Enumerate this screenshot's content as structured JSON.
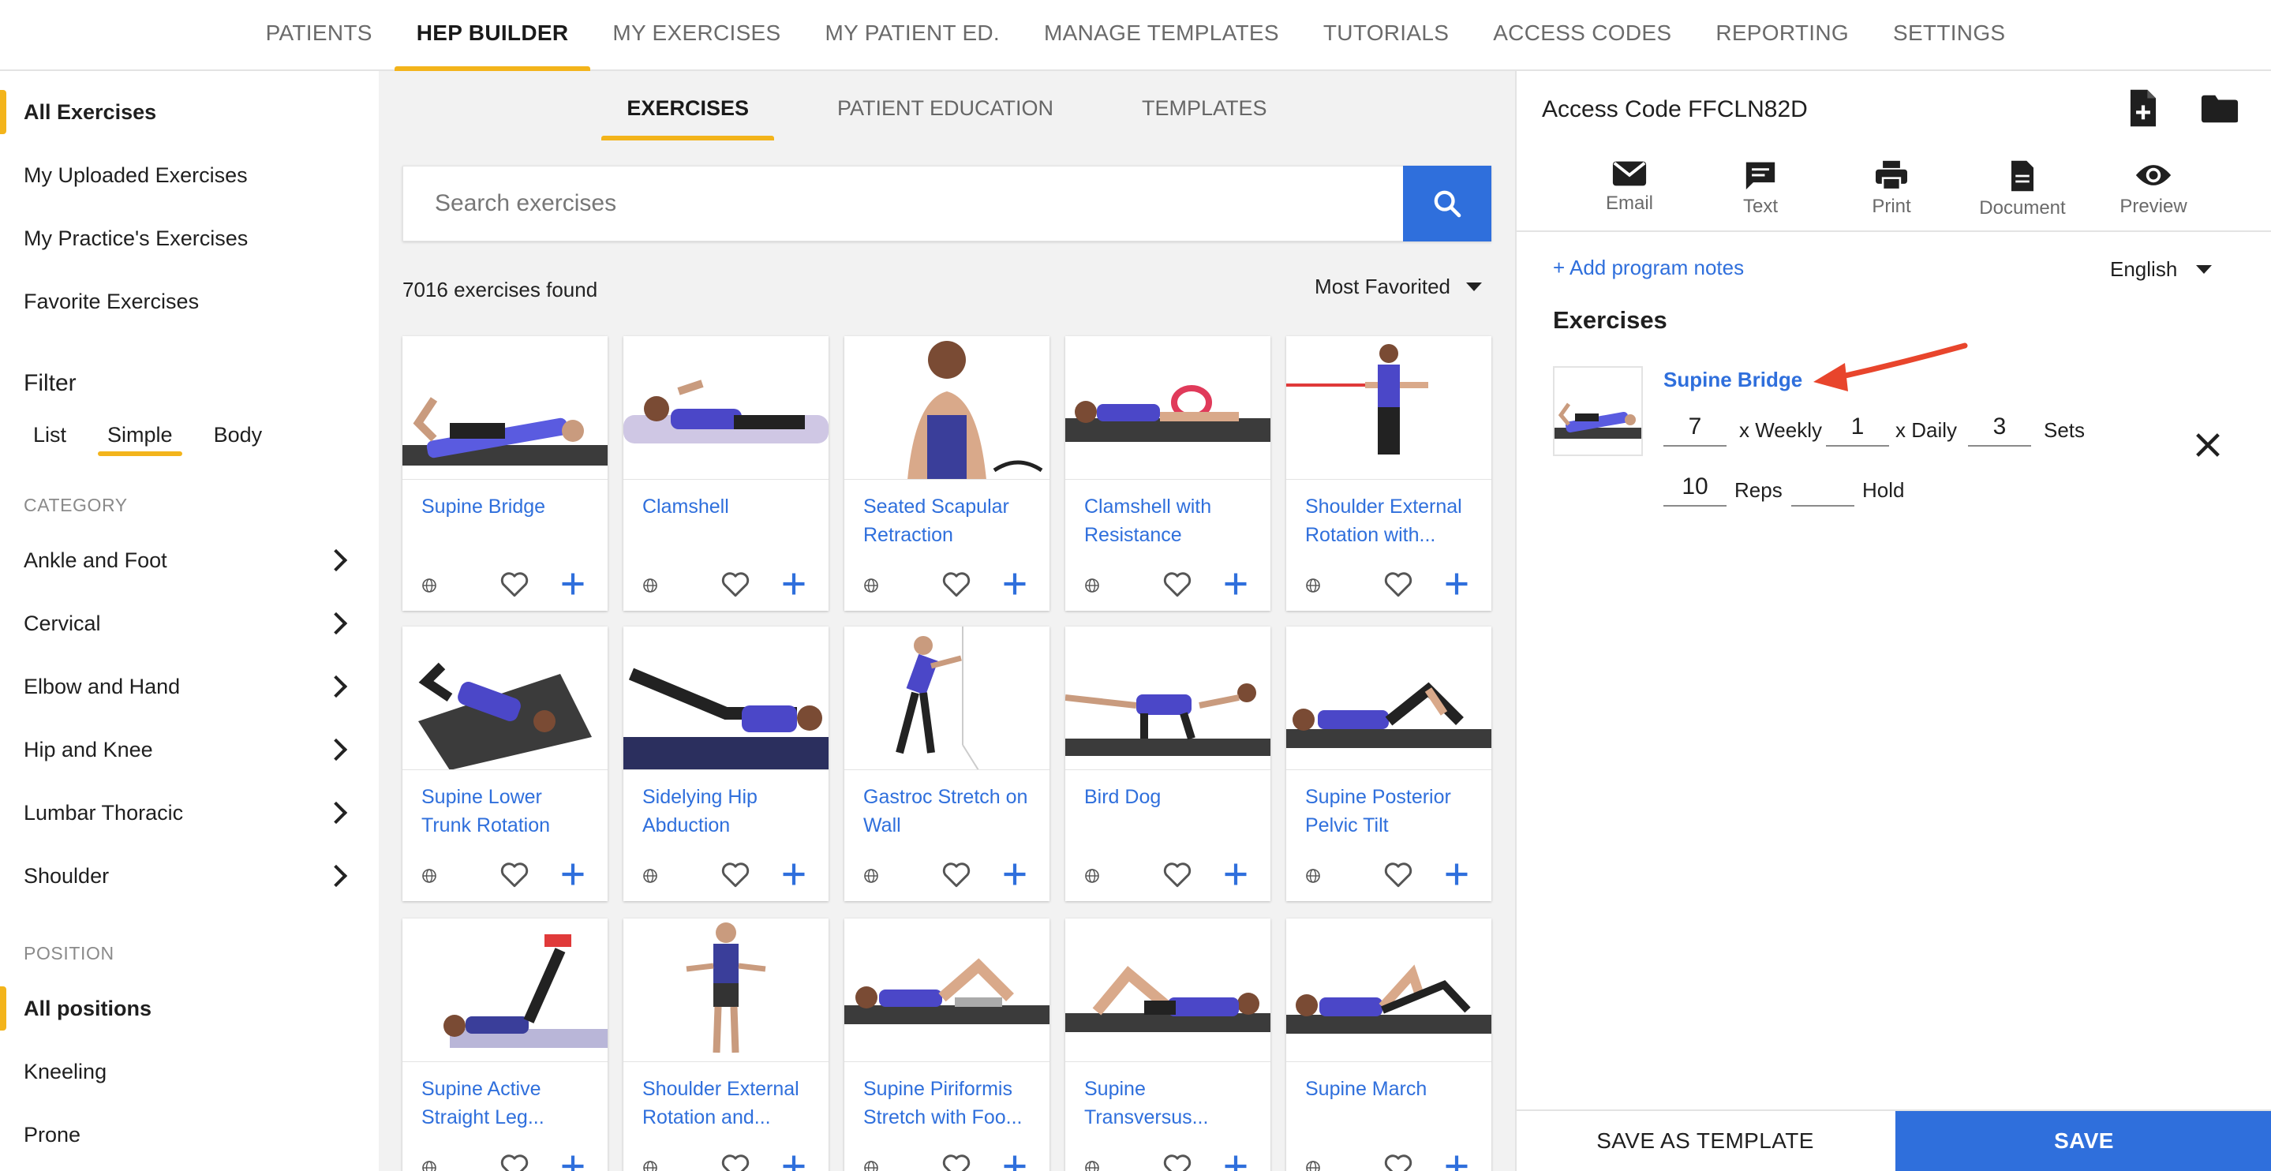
{
  "topnav": {
    "tabs": [
      "PATIENTS",
      "HEP BUILDER",
      "MY EXERCISES",
      "MY PATIENT ED.",
      "MANAGE TEMPLATES",
      "TUTORIALS",
      "ACCESS CODES",
      "REPORTING",
      "SETTINGS"
    ],
    "active": "HEP BUILDER"
  },
  "sidebar": {
    "links": [
      "All Exercises",
      "My Uploaded Exercises",
      "My Practice's Exercises",
      "Favorite Exercises"
    ],
    "filter_title": "Filter",
    "filter_tabs": [
      "List",
      "Simple",
      "Body"
    ],
    "category_label": "CATEGORY",
    "categories": [
      "Ankle and Foot",
      "Cervical",
      "Elbow and Hand",
      "Hip and Knee",
      "Lumbar Thoracic",
      "Shoulder"
    ],
    "position_label": "POSITION",
    "positions": [
      "All positions",
      "Kneeling",
      "Prone"
    ]
  },
  "center": {
    "subtabs": [
      "EXERCISES",
      "PATIENT EDUCATION",
      "TEMPLATES"
    ],
    "search_placeholder": "Search exercises",
    "results": "7016 exercises found",
    "sort": "Most Favorited",
    "cards": [
      "Supine Bridge",
      "Clamshell",
      "Seated Scapular Retraction",
      "Clamshell with Resistance",
      "Shoulder External Rotation with...",
      "Supine Lower Trunk Rotation",
      "Sidelying Hip Abduction",
      "Gastroc Stretch on Wall",
      "Bird Dog",
      "Supine Posterior Pelvic Tilt",
      "Supine Active Straight Leg...",
      "Shoulder External Rotation and...",
      "Supine Piriformis Stretch with Foo...",
      "Supine Transversus...",
      "Supine March"
    ]
  },
  "right": {
    "access_label": "Access Code",
    "access_code": "FFCLN82D",
    "share": [
      "Email",
      "Text",
      "Print",
      "Document",
      "Preview"
    ],
    "add_notes": "+ Add program notes",
    "language": "English",
    "exercises_header": "Exercises",
    "program": {
      "name": "Supine Bridge",
      "weekly": "7",
      "weekly_label": "x Weekly",
      "daily": "1",
      "daily_label": "x Daily",
      "sets": "3",
      "sets_label": "Sets",
      "reps": "10",
      "reps_label": "Reps",
      "hold": "",
      "hold_label": "Hold"
    },
    "save_template": "SAVE AS TEMPLATE",
    "save": "SAVE"
  },
  "colors": {
    "accent": "#f3b41b",
    "primary": "#2f6fdc",
    "arrow": "#e8452c"
  }
}
